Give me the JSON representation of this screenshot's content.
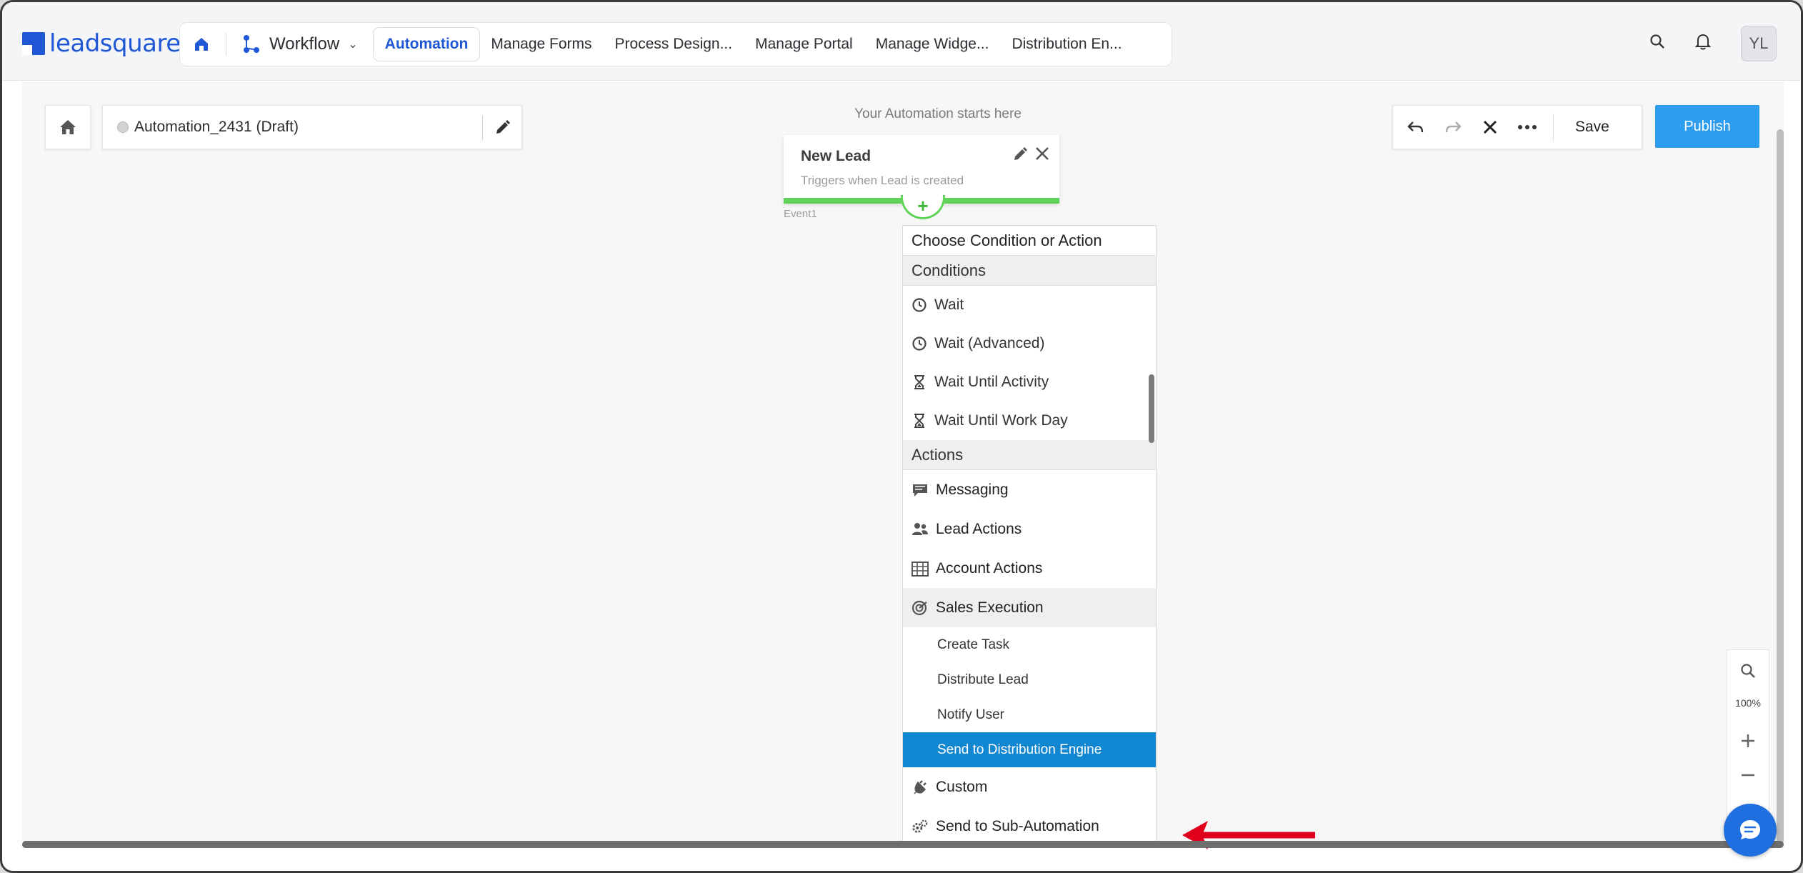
{
  "header": {
    "logo_text": "leadsquared",
    "workflow_label": "Workflow",
    "tabs": [
      {
        "label": "Automation"
      },
      {
        "label": "Manage Forms"
      },
      {
        "label": "Process Design..."
      },
      {
        "label": "Manage Portal"
      },
      {
        "label": "Manage Widge..."
      },
      {
        "label": "Distribution En..."
      }
    ],
    "avatar_initials": "YL",
    "icons": [
      "home-icon",
      "workflow-icon",
      "chevron-down-icon",
      "search-icon",
      "bell-icon"
    ]
  },
  "automation": {
    "name": "Automation_2431 (Draft)",
    "starts_here": "Your Automation starts here",
    "event": {
      "title": "New Lead",
      "subtitle": "Triggers when Lead is created",
      "label": "Event1"
    }
  },
  "dropdown": {
    "heading": "Choose Condition or Action",
    "conditions_title": "Conditions",
    "conditions": [
      {
        "label": "Wait",
        "icon": "clock-icon"
      },
      {
        "label": "Wait (Advanced)",
        "icon": "clock-icon"
      },
      {
        "label": "Wait Until Activity",
        "icon": "hourglass-icon"
      },
      {
        "label": "Wait Until Work Day",
        "icon": "hourglass-icon"
      }
    ],
    "actions_title": "Actions",
    "actions": [
      {
        "label": "Messaging",
        "icon": "message-icon"
      },
      {
        "label": "Lead Actions",
        "icon": "users-icon"
      },
      {
        "label": "Account Actions",
        "icon": "building-icon"
      },
      {
        "label": "Sales Execution",
        "icon": "target-icon"
      }
    ],
    "sales_execution_items": [
      {
        "label": "Create Task"
      },
      {
        "label": "Distribute Lead"
      },
      {
        "label": "Notify User"
      },
      {
        "label": "Send to Distribution Engine"
      }
    ],
    "more_actions": [
      {
        "label": "Custom",
        "icon": "plug-icon"
      },
      {
        "label": "Send to Sub-Automation",
        "icon": "gears-icon"
      }
    ]
  },
  "toolbar": {
    "save_label": "Save",
    "publish_label": "Publish"
  },
  "zoom": {
    "level": "100%"
  },
  "colors": {
    "brand": "#1f57d6",
    "publish": "#2e9df0",
    "selected": "#1186d1",
    "event_bar": "#5fd35a",
    "arrow": "#e0001b"
  }
}
